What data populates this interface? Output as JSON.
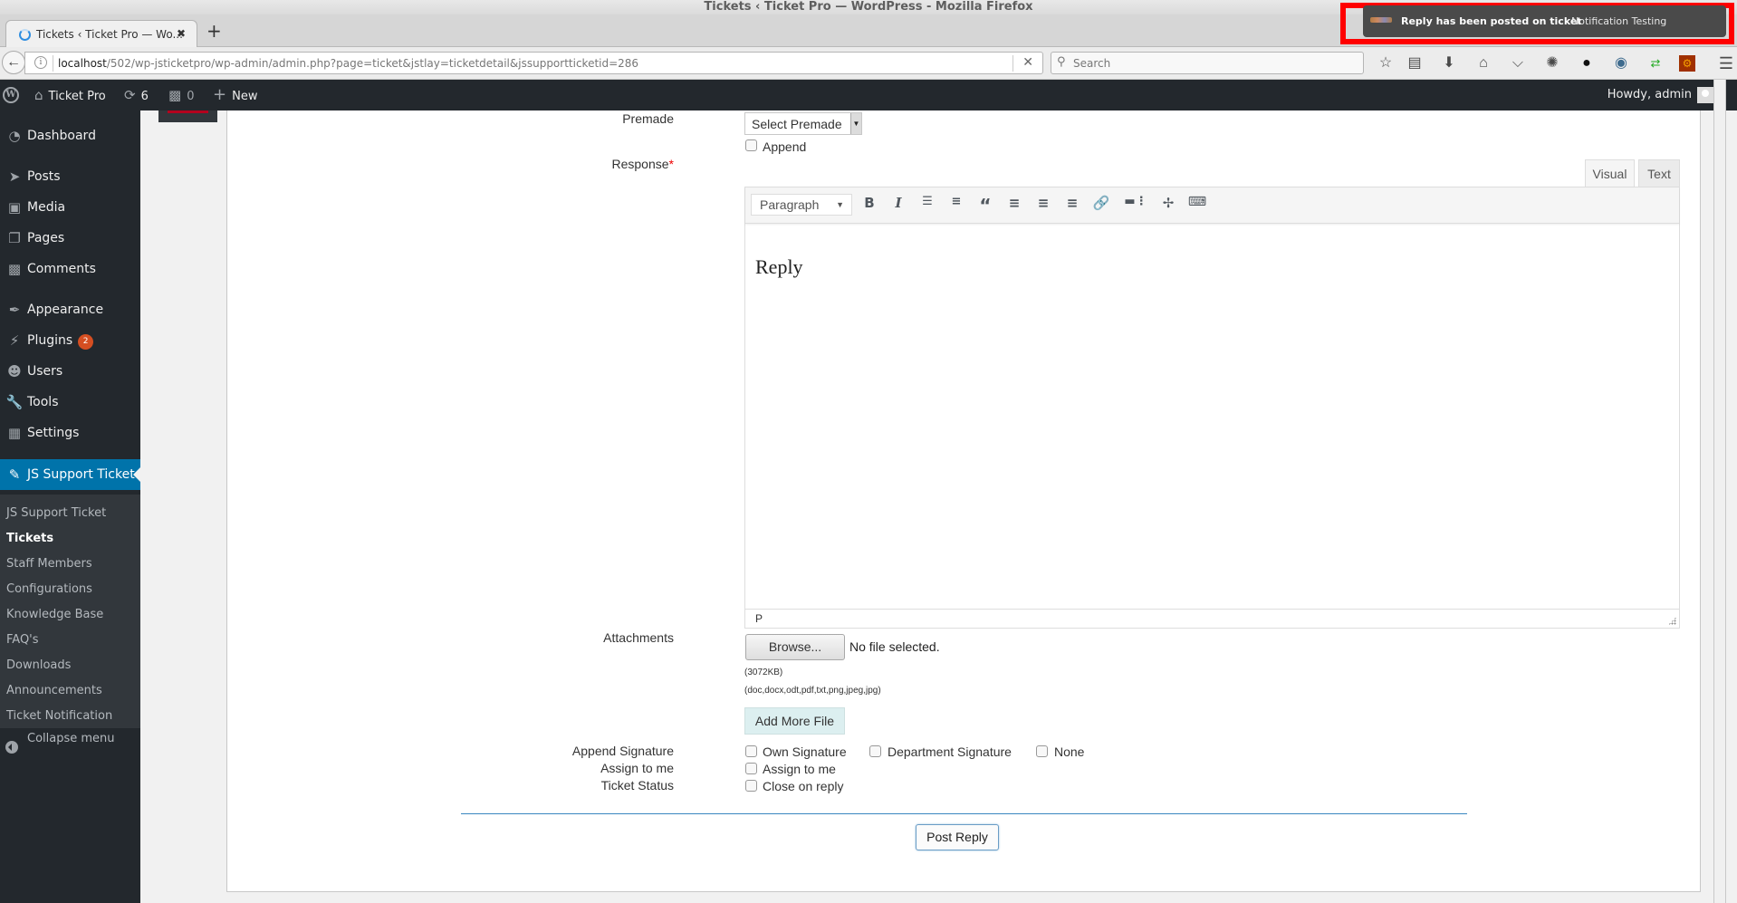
{
  "window": {
    "title": "Tickets ‹ Ticket Pro — WordPress - Mozilla Firefox"
  },
  "browser": {
    "tab": {
      "label": "Tickets ‹ Ticket Pro — Wo...",
      "close": "✖"
    },
    "new_tab": "+",
    "url_host": "localhost",
    "url_path": "/502/wp-jsticketpro/wp-admin/admin.php?page=ticket&jstlay=ticketdetail&jssupportticketid=286",
    "url_clear": "✕",
    "search_placeholder": "Search",
    "toolbar_icons": [
      "bookmark-star-icon",
      "reading-list-icon",
      "download-icon",
      "home-icon",
      "pocket-icon",
      "web-developer-icon",
      "color-picker-icon",
      "screenshot-icon",
      "sync-arrows-icon",
      "addon-gear-icon",
      "hamburger-menu-icon"
    ]
  },
  "notification": {
    "title": "Reply has been posted on ticket",
    "body": "Notification Testing"
  },
  "adminbar": {
    "site_name": "Ticket Pro",
    "updates_count": "6",
    "comments_count": "0",
    "new_label": "New",
    "howdy": "Howdy, admin"
  },
  "sidebar": {
    "items": [
      {
        "label": "Dashboard",
        "icon": "dashboard-icon"
      },
      {
        "label": "Posts",
        "icon": "pin-icon"
      },
      {
        "label": "Media",
        "icon": "media-icon"
      },
      {
        "label": "Pages",
        "icon": "pages-icon"
      },
      {
        "label": "Comments",
        "icon": "comment-icon"
      },
      {
        "label": "Appearance",
        "icon": "brush-icon"
      },
      {
        "label": "Plugins",
        "icon": "plugin-icon",
        "badge": "2"
      },
      {
        "label": "Users",
        "icon": "user-icon"
      },
      {
        "label": "Tools",
        "icon": "wrench-icon"
      },
      {
        "label": "Settings",
        "icon": "settings-icon"
      },
      {
        "label": "JS Support Ticket",
        "icon": "ticket-icon"
      }
    ],
    "submenu": [
      "JS Support Ticket",
      "Tickets",
      "Staff Members",
      "Configurations",
      "Knowledge Base",
      "FAQ's",
      "Downloads",
      "Announcements",
      "Ticket Notification"
    ],
    "active_submenu": "Tickets",
    "collapse_label": "Collapse menu"
  },
  "form": {
    "premade_label": "Premade",
    "premade_value": "Select Premade",
    "append_label": "Append",
    "response_label": "Response",
    "required_mark": "*",
    "editor_tabs": {
      "visual": "Visual",
      "text": "Text"
    },
    "format_select": "Paragraph",
    "toolbar_buttons": [
      "bold",
      "italic",
      "bullet-list",
      "numbered-list",
      "blockquote",
      "align-left",
      "align-center",
      "align-right",
      "link",
      "read-more",
      "fullscreen",
      "toolbar-toggle"
    ],
    "editor_content": "Reply",
    "editor_path": "P",
    "attachments_label": "Attachments",
    "browse_label": "Browse...",
    "no_file": "No file selected.",
    "max_size": "(3072KB)",
    "allowed_types": "(doc,docx,odt,pdf,txt,png,jpeg,jpg)",
    "add_more_label": "Add More File",
    "append_signature_label": "Append Signature",
    "signature_options": [
      "Own Signature",
      "Department Signature",
      "None"
    ],
    "assign_label": "Assign to me",
    "assign_option": "Assign to me",
    "status_label": "Ticket Status",
    "status_option": "Close on reply",
    "post_reply": "Post Reply"
  }
}
